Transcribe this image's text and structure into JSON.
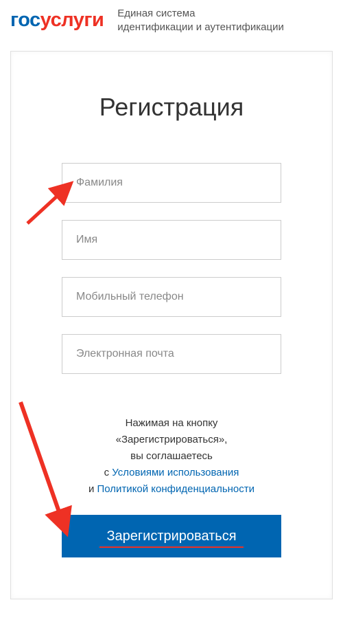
{
  "header": {
    "logo_gos": "гос",
    "logo_uslugi": "услуги",
    "subtitle_line1": "Единая система",
    "subtitle_line2": "идентификации и аутентификации"
  },
  "form": {
    "title": "Регистрация",
    "surname_placeholder": "Фамилия",
    "name_placeholder": "Имя",
    "phone_placeholder": "Мобильный телефон",
    "email_placeholder": "Электронная почта"
  },
  "terms": {
    "line1": "Нажимая на кнопку",
    "line2": "«Зарегистрироваться»,",
    "line3": "вы соглашаетесь",
    "line4_prefix": "с ",
    "terms_link": "Условиями использования",
    "line5_prefix": "и ",
    "privacy_link": "Политикой конфиденциальности"
  },
  "button": {
    "register_label": "Зарегистрироваться"
  }
}
